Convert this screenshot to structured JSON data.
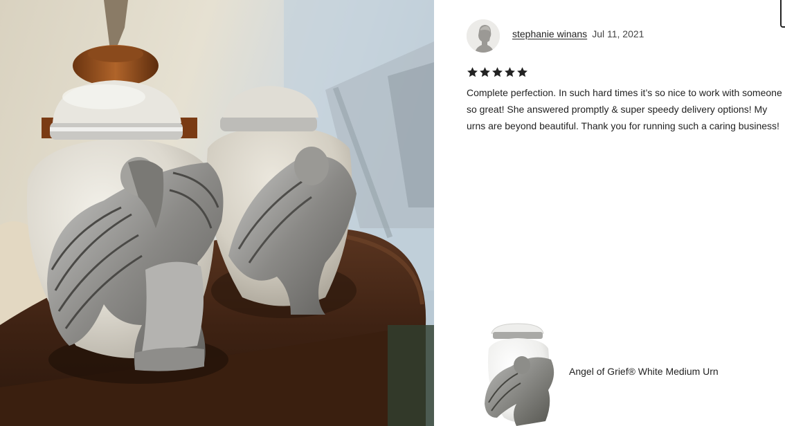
{
  "review": {
    "reviewer_name": "stephanie winans",
    "date": "Jul 11, 2021",
    "rating": 5,
    "text": "Complete perfection. In such hard times it’s so nice to work with someone so great! She answered promptly & super speedy delivery options! My urns are beyond beautiful. Thank you for running such a caring business!"
  },
  "product": {
    "name": "Angel of Grief® White Medium Urn"
  },
  "icons": {
    "avatar": "default-user-avatar-icon",
    "rating_star": "star-icon"
  },
  "colors": {
    "text": "#222222",
    "star": "#222222",
    "background": "#ffffff"
  }
}
